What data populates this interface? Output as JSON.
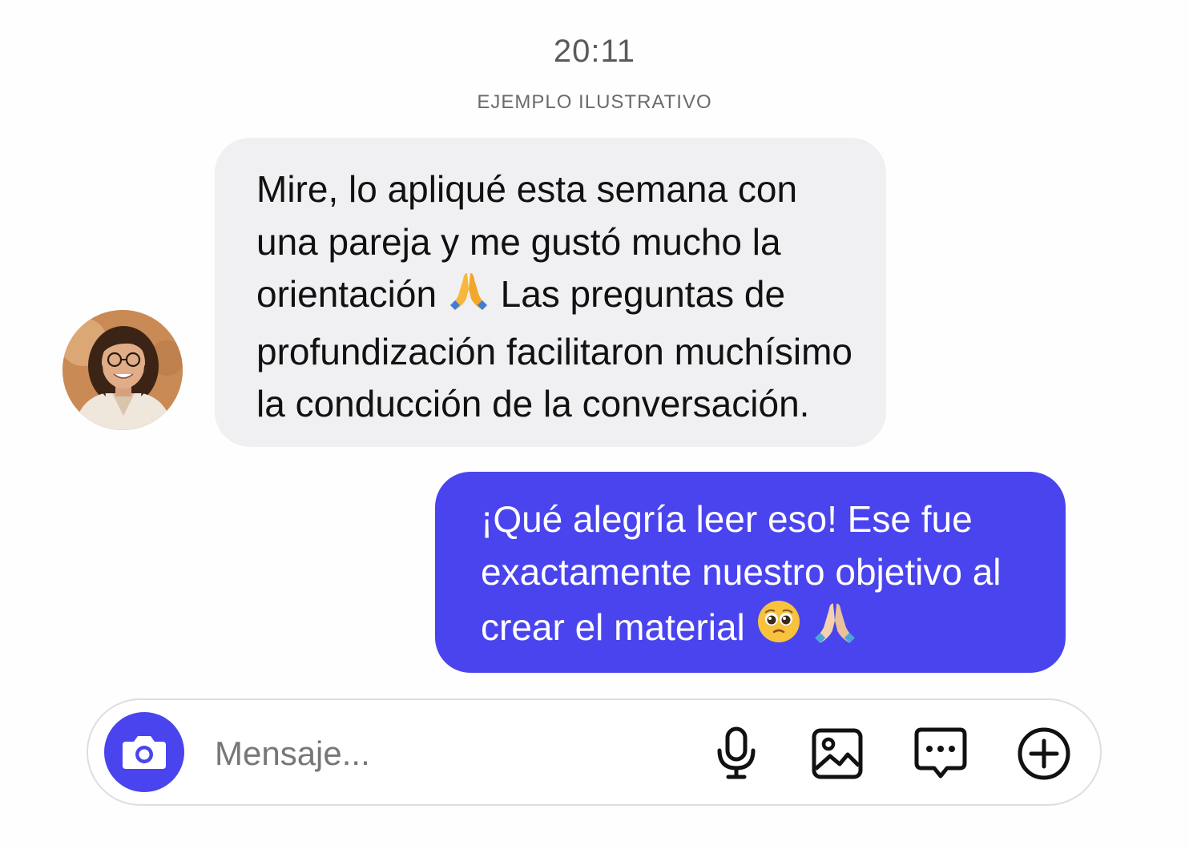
{
  "chat": {
    "timestamp": "20:11",
    "disclaimer": "EJEMPLO ILUSTRATIVO"
  },
  "messages": [
    {
      "direction": "incoming",
      "lines": [
        "Mire, lo apliqué esta semana con",
        "una pareja y me gustó mucho la",
        "orientación",
        "Las preguntas de",
        "profundización facilitaron muchísimo",
        "la conducción de la conversación."
      ],
      "emojis": [
        "folded-hands-icon"
      ]
    },
    {
      "direction": "outgoing",
      "lines": [
        "¡Qué alegría leer eso! Ese fue",
        "exactamente nuestro objetivo al",
        "crear el material"
      ],
      "emojis": [
        "pleading-face-icon",
        "folded-hands-icon"
      ]
    }
  ],
  "composer": {
    "placeholder": "Mensaje...",
    "icons": [
      "camera-icon",
      "microphone-icon",
      "gallery-icon",
      "sticker-chat-icon",
      "plus-circle-icon"
    ]
  },
  "colors": {
    "accent": "#4a44ee",
    "incoming_bubble": "#f0f0f2",
    "outgoing_text": "#ffffff"
  }
}
